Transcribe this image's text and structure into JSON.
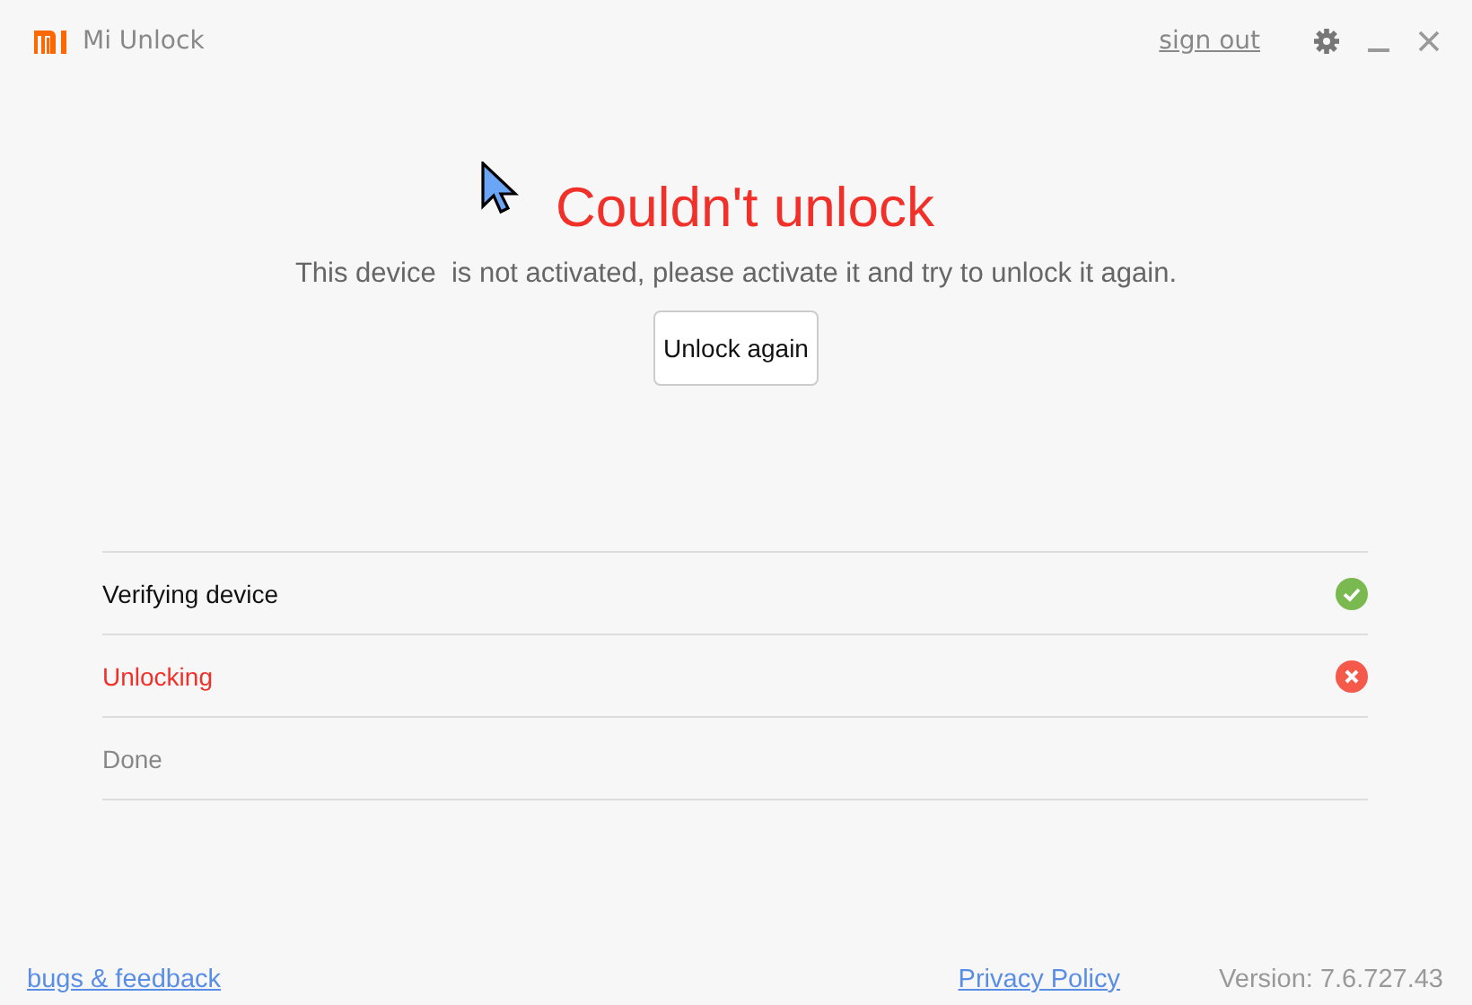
{
  "window": {
    "title": "Mi Unlock",
    "sign_out": "sign out"
  },
  "result": {
    "title": "Couldn't unlock",
    "message": "This device  is not activated, please activate it and try to unlock it again.",
    "button": "Unlock again"
  },
  "steps": [
    {
      "label": "Verifying device",
      "kind": "done"
    },
    {
      "label": "Unlocking",
      "kind": "failed"
    },
    {
      "label": "Done",
      "kind": "pending"
    }
  ],
  "footer": {
    "feedback": "bugs & feedback",
    "privacy": "Privacy Policy",
    "version": "Version: 7.6.727.43"
  }
}
